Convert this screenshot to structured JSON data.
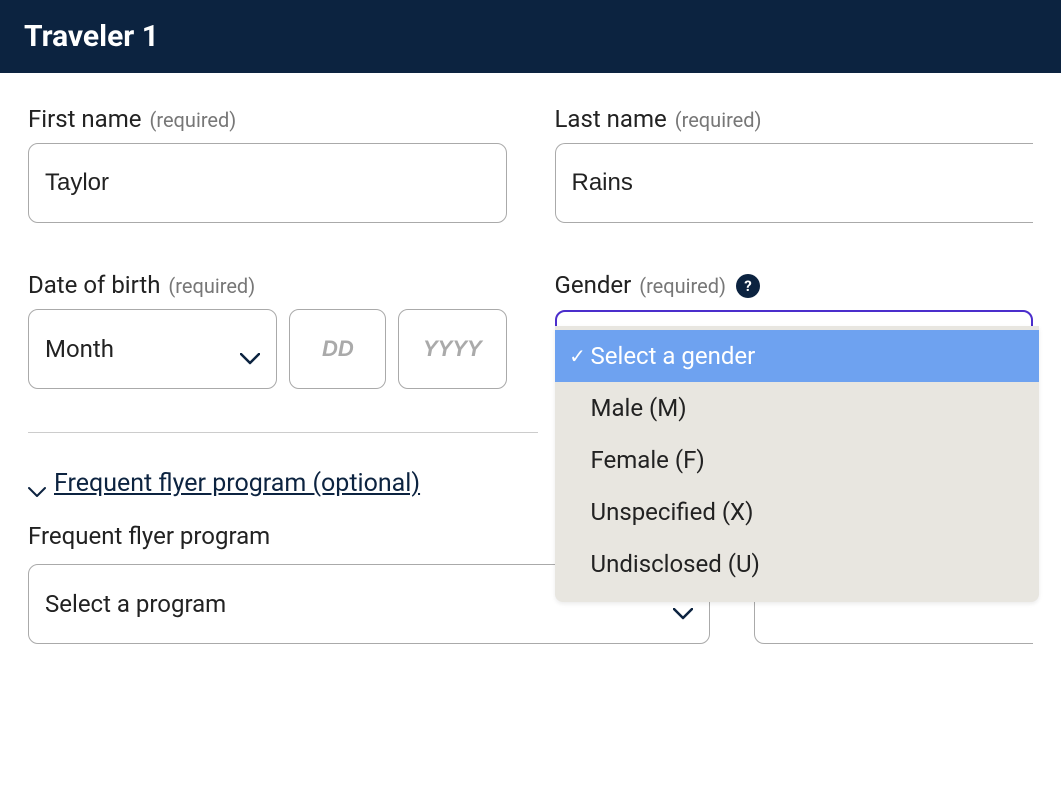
{
  "header": {
    "title": "Traveler 1"
  },
  "fields": {
    "first_name": {
      "label": "First name",
      "required": "(required)",
      "value": "Taylor"
    },
    "last_name": {
      "label": "Last name",
      "required": "(required)",
      "value": "Rains"
    },
    "dob": {
      "label": "Date of birth",
      "required": "(required)",
      "month_placeholder": "Month",
      "dd_placeholder": "DD",
      "yyyy_placeholder": "YYYY"
    },
    "gender": {
      "label": "Gender",
      "required": "(required)",
      "help": "?",
      "options": [
        "Select a gender",
        "Male (M)",
        "Female (F)",
        "Unspecified (X)",
        "Undisclosed (U)"
      ],
      "selected_index": 0
    }
  },
  "frequent_flyer": {
    "toggle_text": "Frequent flyer program (optional)",
    "label": "Frequent flyer program",
    "select_placeholder": "Select a program"
  }
}
